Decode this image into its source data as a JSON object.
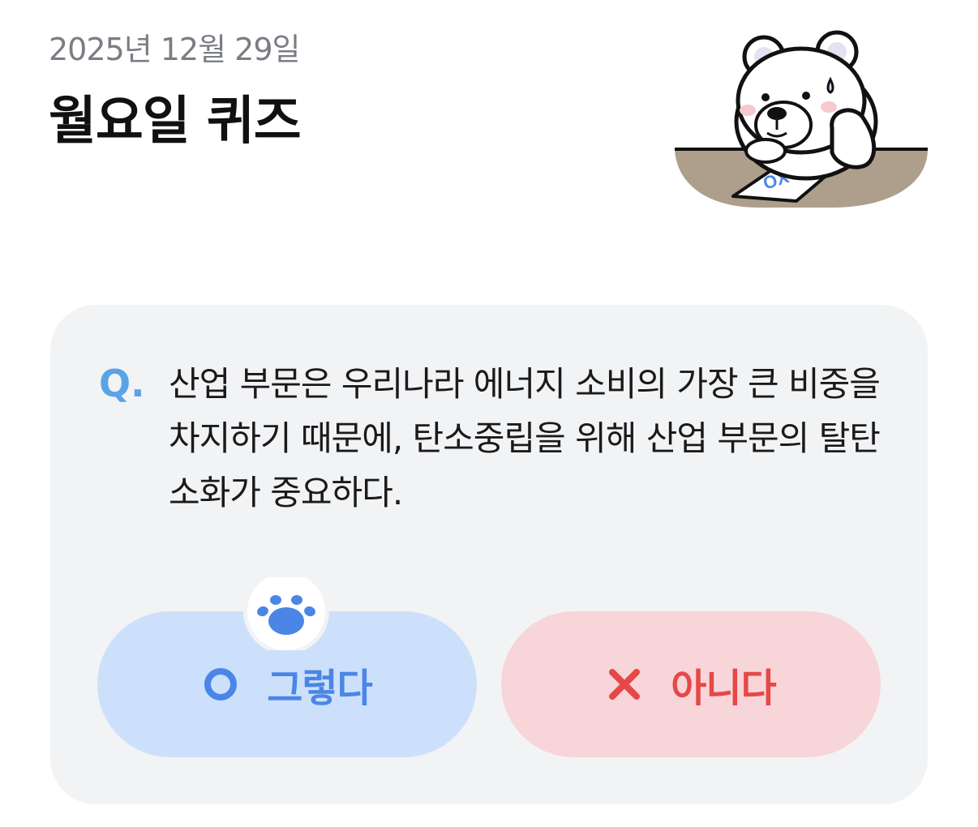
{
  "header": {
    "date": "2025년 12월 29일",
    "title": "월요일 퀴즈"
  },
  "mascot": {
    "icon": "bear-with-ox-paper-illustration",
    "paper_text": "OX"
  },
  "quiz": {
    "q_label": "Q.",
    "question": "산업 부문은 우리나라 에너지 소비의 가장 큰 비중을 차지하기 때문에, 탄소중립을 위해 산업 부문의 탈탄소화가 중요하다.",
    "options": {
      "yes": {
        "label": "그렇다",
        "icon": "circle-o-icon",
        "color": "#4b86e6"
      },
      "no": {
        "label": "아니다",
        "icon": "x-mark-icon",
        "color": "#e54848"
      }
    },
    "paw_icon": "paw-icon"
  },
  "colors": {
    "card_bg": "#f2f3f5",
    "yes_bg": "#cde0fb",
    "no_bg": "#f7d5d8",
    "q_accent": "#5aa3e6"
  }
}
